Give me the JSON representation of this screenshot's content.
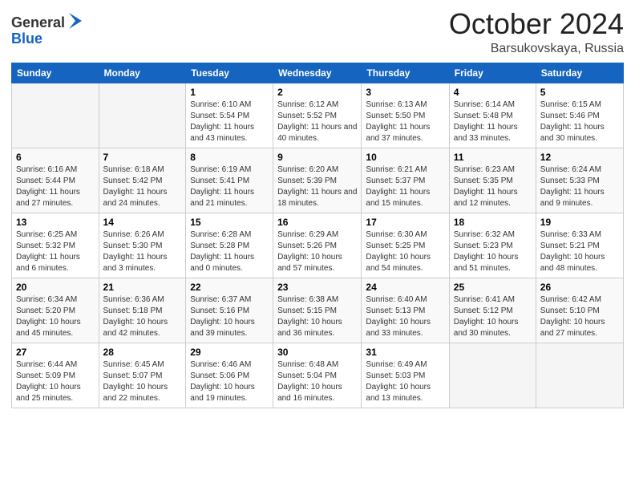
{
  "header": {
    "logo_general": "General",
    "logo_blue": "Blue",
    "month": "October 2024",
    "location": "Barsukovskaya, Russia"
  },
  "weekdays": [
    "Sunday",
    "Monday",
    "Tuesday",
    "Wednesday",
    "Thursday",
    "Friday",
    "Saturday"
  ],
  "weeks": [
    [
      {
        "day": "",
        "info": ""
      },
      {
        "day": "",
        "info": ""
      },
      {
        "day": "1",
        "info": "Sunrise: 6:10 AM\nSunset: 5:54 PM\nDaylight: 11 hours and 43 minutes."
      },
      {
        "day": "2",
        "info": "Sunrise: 6:12 AM\nSunset: 5:52 PM\nDaylight: 11 hours and 40 minutes."
      },
      {
        "day": "3",
        "info": "Sunrise: 6:13 AM\nSunset: 5:50 PM\nDaylight: 11 hours and 37 minutes."
      },
      {
        "day": "4",
        "info": "Sunrise: 6:14 AM\nSunset: 5:48 PM\nDaylight: 11 hours and 33 minutes."
      },
      {
        "day": "5",
        "info": "Sunrise: 6:15 AM\nSunset: 5:46 PM\nDaylight: 11 hours and 30 minutes."
      }
    ],
    [
      {
        "day": "6",
        "info": "Sunrise: 6:16 AM\nSunset: 5:44 PM\nDaylight: 11 hours and 27 minutes."
      },
      {
        "day": "7",
        "info": "Sunrise: 6:18 AM\nSunset: 5:42 PM\nDaylight: 11 hours and 24 minutes."
      },
      {
        "day": "8",
        "info": "Sunrise: 6:19 AM\nSunset: 5:41 PM\nDaylight: 11 hours and 21 minutes."
      },
      {
        "day": "9",
        "info": "Sunrise: 6:20 AM\nSunset: 5:39 PM\nDaylight: 11 hours and 18 minutes."
      },
      {
        "day": "10",
        "info": "Sunrise: 6:21 AM\nSunset: 5:37 PM\nDaylight: 11 hours and 15 minutes."
      },
      {
        "day": "11",
        "info": "Sunrise: 6:23 AM\nSunset: 5:35 PM\nDaylight: 11 hours and 12 minutes."
      },
      {
        "day": "12",
        "info": "Sunrise: 6:24 AM\nSunset: 5:33 PM\nDaylight: 11 hours and 9 minutes."
      }
    ],
    [
      {
        "day": "13",
        "info": "Sunrise: 6:25 AM\nSunset: 5:32 PM\nDaylight: 11 hours and 6 minutes."
      },
      {
        "day": "14",
        "info": "Sunrise: 6:26 AM\nSunset: 5:30 PM\nDaylight: 11 hours and 3 minutes."
      },
      {
        "day": "15",
        "info": "Sunrise: 6:28 AM\nSunset: 5:28 PM\nDaylight: 11 hours and 0 minutes."
      },
      {
        "day": "16",
        "info": "Sunrise: 6:29 AM\nSunset: 5:26 PM\nDaylight: 10 hours and 57 minutes."
      },
      {
        "day": "17",
        "info": "Sunrise: 6:30 AM\nSunset: 5:25 PM\nDaylight: 10 hours and 54 minutes."
      },
      {
        "day": "18",
        "info": "Sunrise: 6:32 AM\nSunset: 5:23 PM\nDaylight: 10 hours and 51 minutes."
      },
      {
        "day": "19",
        "info": "Sunrise: 6:33 AM\nSunset: 5:21 PM\nDaylight: 10 hours and 48 minutes."
      }
    ],
    [
      {
        "day": "20",
        "info": "Sunrise: 6:34 AM\nSunset: 5:20 PM\nDaylight: 10 hours and 45 minutes."
      },
      {
        "day": "21",
        "info": "Sunrise: 6:36 AM\nSunset: 5:18 PM\nDaylight: 10 hours and 42 minutes."
      },
      {
        "day": "22",
        "info": "Sunrise: 6:37 AM\nSunset: 5:16 PM\nDaylight: 10 hours and 39 minutes."
      },
      {
        "day": "23",
        "info": "Sunrise: 6:38 AM\nSunset: 5:15 PM\nDaylight: 10 hours and 36 minutes."
      },
      {
        "day": "24",
        "info": "Sunrise: 6:40 AM\nSunset: 5:13 PM\nDaylight: 10 hours and 33 minutes."
      },
      {
        "day": "25",
        "info": "Sunrise: 6:41 AM\nSunset: 5:12 PM\nDaylight: 10 hours and 30 minutes."
      },
      {
        "day": "26",
        "info": "Sunrise: 6:42 AM\nSunset: 5:10 PM\nDaylight: 10 hours and 27 minutes."
      }
    ],
    [
      {
        "day": "27",
        "info": "Sunrise: 6:44 AM\nSunset: 5:09 PM\nDaylight: 10 hours and 25 minutes."
      },
      {
        "day": "28",
        "info": "Sunrise: 6:45 AM\nSunset: 5:07 PM\nDaylight: 10 hours and 22 minutes."
      },
      {
        "day": "29",
        "info": "Sunrise: 6:46 AM\nSunset: 5:06 PM\nDaylight: 10 hours and 19 minutes."
      },
      {
        "day": "30",
        "info": "Sunrise: 6:48 AM\nSunset: 5:04 PM\nDaylight: 10 hours and 16 minutes."
      },
      {
        "day": "31",
        "info": "Sunrise: 6:49 AM\nSunset: 5:03 PM\nDaylight: 10 hours and 13 minutes."
      },
      {
        "day": "",
        "info": ""
      },
      {
        "day": "",
        "info": ""
      }
    ]
  ]
}
